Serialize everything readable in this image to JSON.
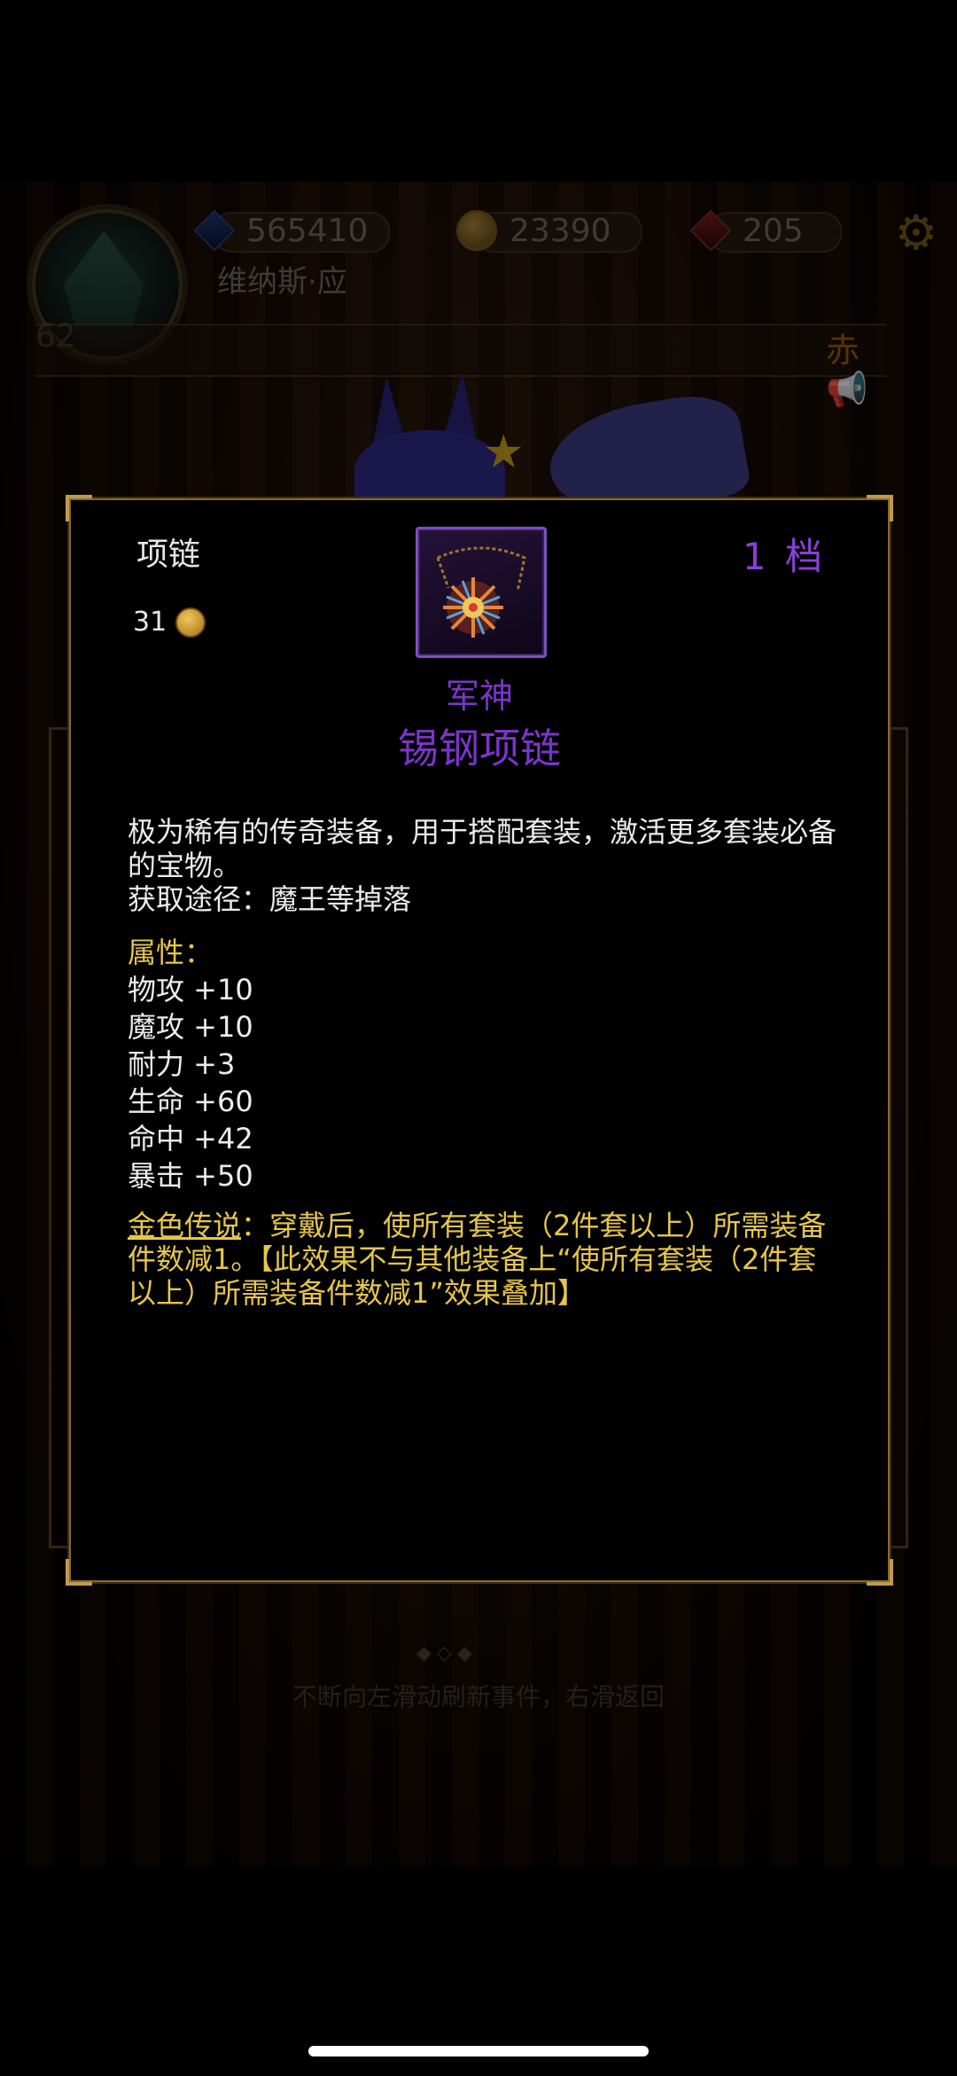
{
  "hud": {
    "level": "62",
    "player_name": "维纳斯·应",
    "diamonds": "565410",
    "gold": "23390",
    "gems": "205",
    "chat_hint": "赤"
  },
  "item": {
    "type": "项链",
    "price": "31",
    "grade": "1 档",
    "set_name": "军神",
    "name": "锡钢项链",
    "description": "极为稀有的传奇装备，用于搭配套装，激活更多套装必备的宝物。",
    "source": "获取途径：魔王等掉落",
    "attributes_title": "属性：",
    "attributes": [
      "物攻 +10",
      "魔攻 +10",
      "耐力 +3",
      "生命 +60",
      "命中 +42",
      "暴击 +50"
    ],
    "legend_label": "金色传说",
    "legend_text": "：穿戴后，使所有套装（2件套以上）所需装备件数减1。【此效果不与其他装备上“使所有套装（2件套以上）所需装备件数减1”效果叠加】"
  },
  "footer": {
    "hint": "不断向左滑动刷新事件，右滑返回"
  },
  "colors": {
    "purple": "#7b35c9",
    "gold_text": "#e6c64a",
    "frame_gold": "#c19a4a"
  }
}
